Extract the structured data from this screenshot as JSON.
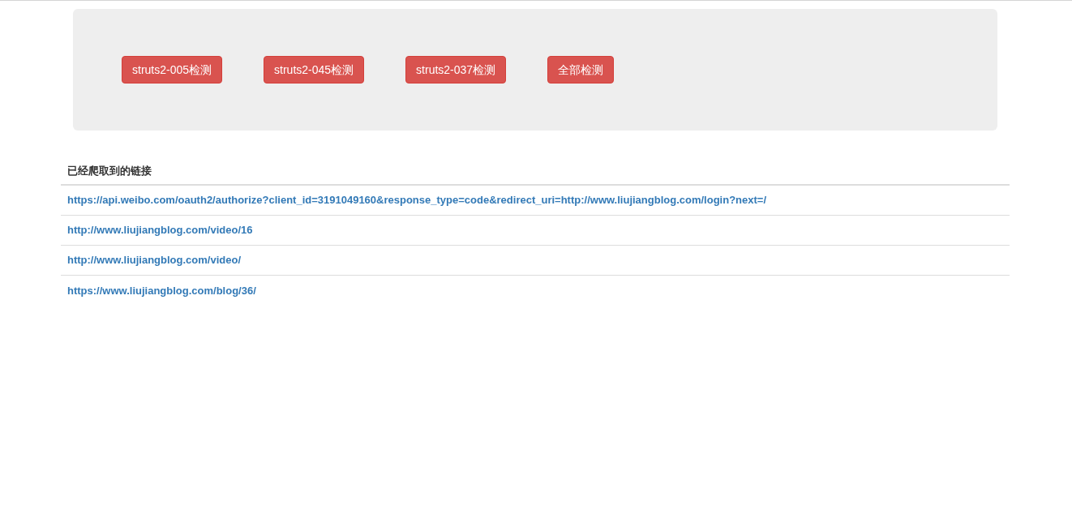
{
  "buttons": [
    {
      "label": "struts2-005检测"
    },
    {
      "label": "struts2-045检测"
    },
    {
      "label": "struts2-037检测"
    },
    {
      "label": "全部检测"
    }
  ],
  "links_table": {
    "heading": "已经爬取到的链接",
    "rows": [
      {
        "url": "https://api.weibo.com/oauth2/authorize?client_id=3191049160&response_type=code&redirect_uri=http://www.liujiangblog.com/login?next=/"
      },
      {
        "url": "http://www.liujiangblog.com/video/16"
      },
      {
        "url": "http://www.liujiangblog.com/video/"
      },
      {
        "url": "https://www.liujiangblog.com/blog/36/"
      }
    ]
  }
}
